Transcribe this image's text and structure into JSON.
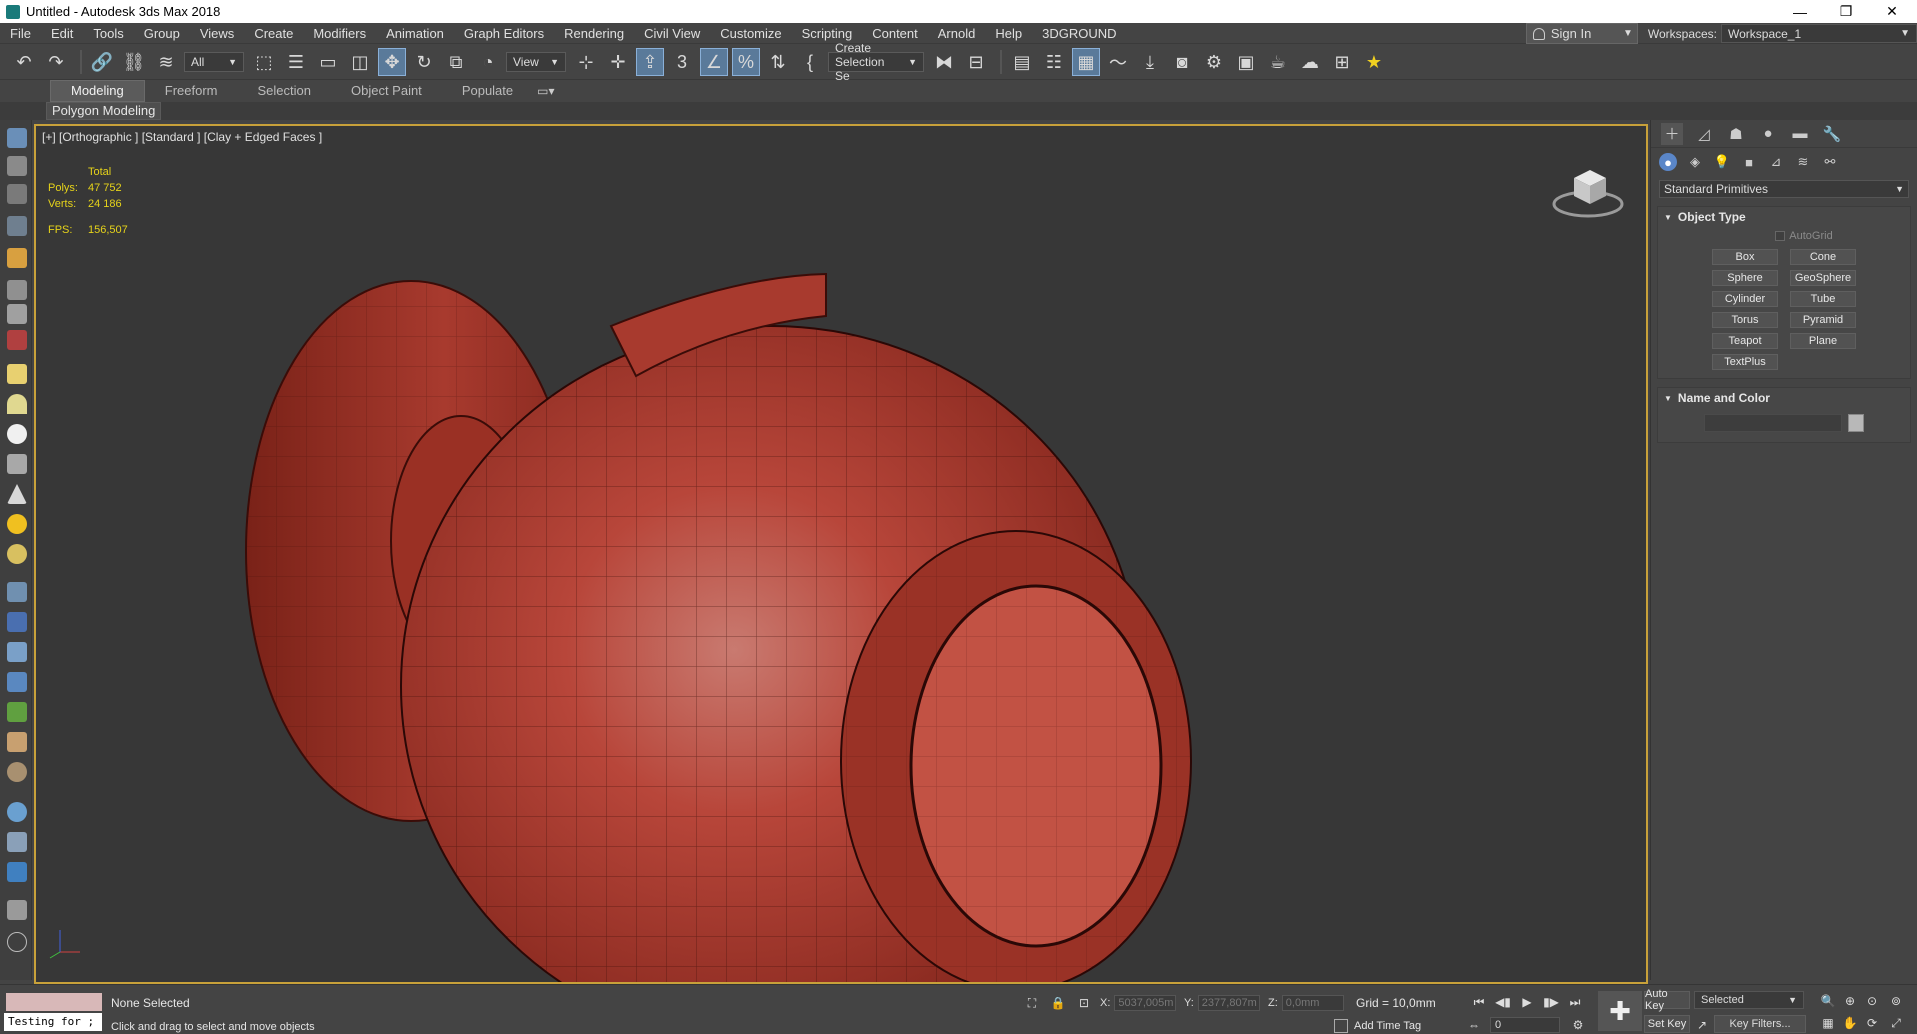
{
  "window": {
    "title": "Untitled - Autodesk 3ds Max 2018",
    "minimize": "—",
    "restore": "❐",
    "close": "✕"
  },
  "menu": {
    "items": [
      "File",
      "Edit",
      "Tools",
      "Group",
      "Views",
      "Create",
      "Modifiers",
      "Animation",
      "Graph Editors",
      "Rendering",
      "Civil View",
      "Customize",
      "Scripting",
      "Content",
      "Arnold",
      "Help",
      "3DGROUND"
    ],
    "sign_in": "Sign In",
    "workspaces_label": "Workspaces:",
    "workspace_value": "Workspace_1"
  },
  "toolbar": {
    "selection_filter": "All",
    "ref_coord": "View",
    "named_selection": "Create Selection Se"
  },
  "ribbon": {
    "tabs": [
      "Modeling",
      "Freeform",
      "Selection",
      "Object Paint",
      "Populate"
    ],
    "active_tab": "Modeling",
    "sub_label": "Polygon Modeling"
  },
  "viewport": {
    "label": "[+] [Orthographic ] [Standard ] [Clay + Edged Faces ]",
    "stats": {
      "total_label": "Total",
      "polys_label": "Polys:",
      "polys_value": "47 752",
      "verts_label": "Verts:",
      "verts_value": "24 186",
      "fps_label": "FPS:",
      "fps_value": "156,507"
    },
    "object_color": "#b84a3a",
    "border_color": "#c8a13a"
  },
  "command_panel": {
    "dropdown": "Standard Primitives",
    "object_type_title": "Object Type",
    "autogrid": "AutoGrid",
    "buttons": [
      "Box",
      "Cone",
      "Sphere",
      "GeoSphere",
      "Cylinder",
      "Tube",
      "Torus",
      "Pyramid",
      "Teapot",
      "Plane",
      "TextPlus"
    ],
    "name_color_title": "Name and Color"
  },
  "statusbar": {
    "maxscript": "Testing for ;",
    "selection_status": "None Selected",
    "prompt": "Click and drag to select and move objects",
    "x_label": "X:",
    "x_value": "5037,005m",
    "y_label": "Y:",
    "y_value": "2377,807m",
    "z_label": "Z:",
    "z_value": "0,0mm",
    "grid": "Grid = 10,0mm",
    "add_time_tag": "Add Time Tag",
    "frame": "0",
    "auto_key": "Auto Key",
    "set_key": "Set Key",
    "key_selected": "Selected",
    "key_filters": "Key Filters..."
  },
  "icons": {
    "undo": "undo-icon",
    "redo": "redo-icon",
    "move": "move-icon",
    "rotate": "rotate-icon",
    "scale": "scale-icon"
  }
}
